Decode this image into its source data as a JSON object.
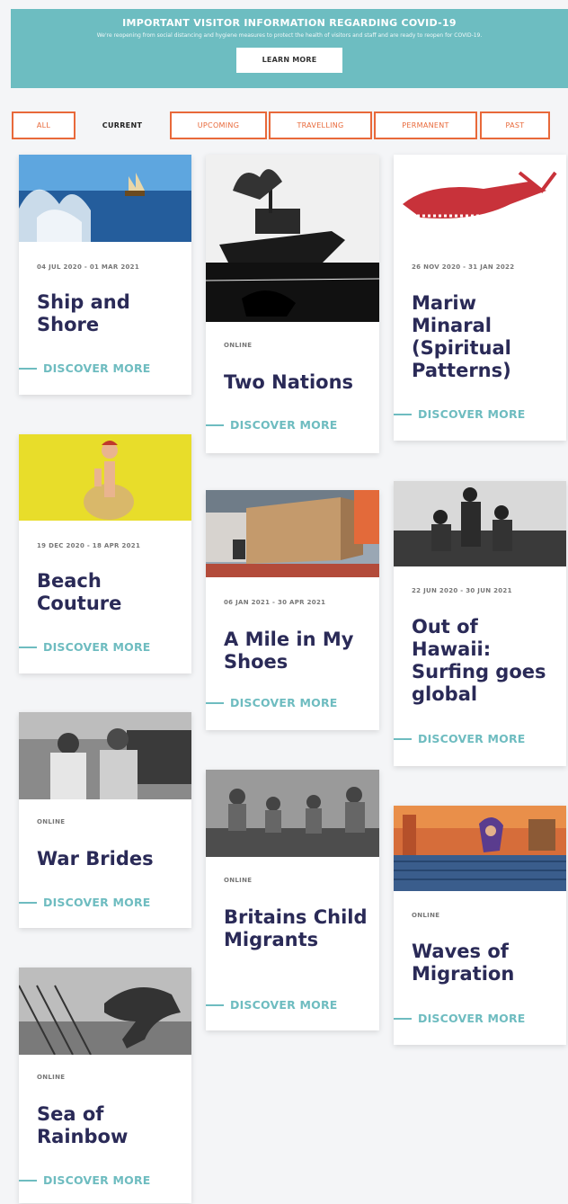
{
  "banner": {
    "title": "IMPORTANT VISITOR INFORMATION REGARDING COVID-19",
    "subtitle": "We're reopening from social distancing and hygiene measures to protect the health of visitors and staff and are ready to reopen for COVID-19.",
    "button": "LEARN MORE"
  },
  "tabs": [
    {
      "label": "ALL"
    },
    {
      "label": "CURRENT"
    },
    {
      "label": "UPCOMING"
    },
    {
      "label": "TRAVELLING"
    },
    {
      "label": "PERMANENT"
    },
    {
      "label": "PAST"
    }
  ],
  "link_label": "DISCOVER MORE",
  "cards": [
    {
      "meta": "04 JUL 2020 - 01 MAR 2021",
      "title": "Ship and Shore"
    },
    {
      "meta": "ONLINE",
      "title": "Two Nations"
    },
    {
      "meta": "26 NOV 2020 - 31 JAN 2022",
      "title": "Mariw Minaral (Spiritual Patterns)"
    },
    {
      "meta": "19 DEC 2020 - 18 APR 2021",
      "title": "Beach Couture"
    },
    {
      "meta": "06 JAN 2021 - 30 APR 2021",
      "title": "A Mile in My Shoes"
    },
    {
      "meta": "22 JUN 2020 - 30 JUN 2021",
      "title": "Out of Hawaii: Surfing goes global"
    },
    {
      "meta": "ONLINE",
      "title": "War Brides"
    },
    {
      "meta": "ONLINE",
      "title": "Britains Child Migrants"
    },
    {
      "meta": "ONLINE",
      "title": "Waves of Migration"
    },
    {
      "meta": "ONLINE",
      "title": "Sea of Rainbow"
    }
  ]
}
